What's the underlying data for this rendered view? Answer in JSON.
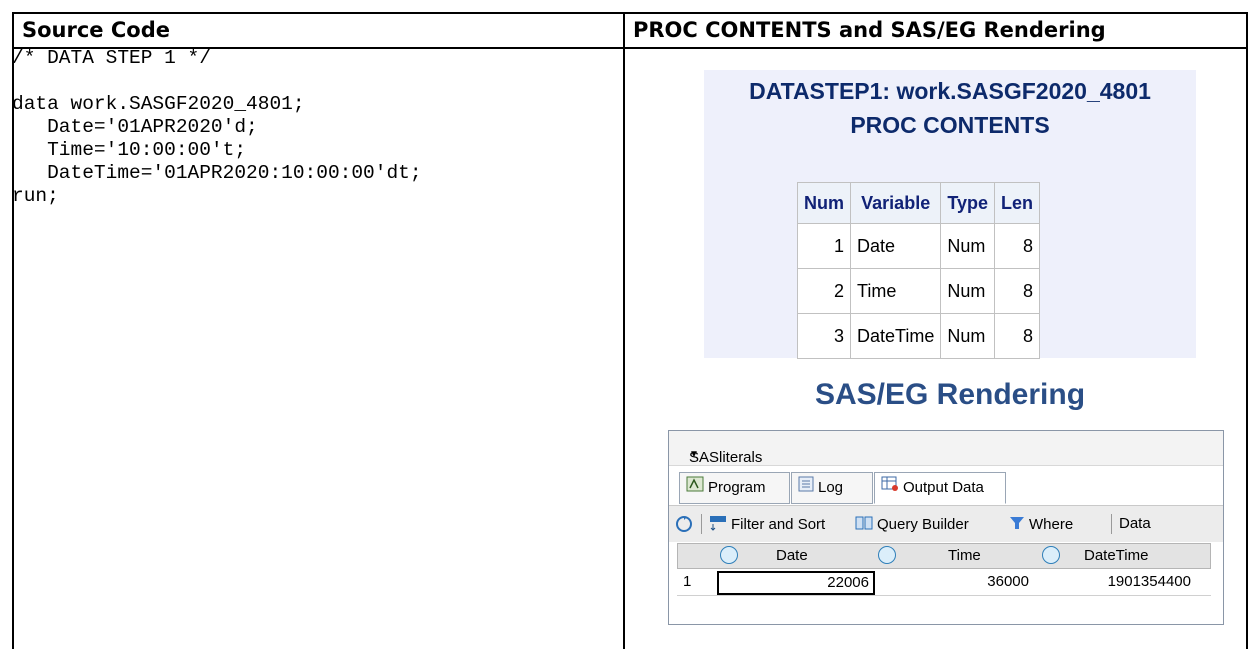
{
  "headers": {
    "left": "Source Code",
    "right": "PROC CONTENTS and SAS/EG Rendering"
  },
  "source_code": [
    "/* DATA STEP 1 */",
    "",
    "data work.SASGF2020_4801;",
    "   Date='01APR2020'd;",
    "   Time='10:00:00't;",
    "   DateTime='01APR2020:10:00:00'dt;",
    "run;"
  ],
  "proc_contents": {
    "title_line1": "DATASTEP1: work.SASGF2020_4801",
    "title_line2": "PROC CONTENTS",
    "columns": [
      "Num",
      "Variable",
      "Type",
      "Len"
    ],
    "rows": [
      [
        "1",
        "Date",
        "Num",
        "8"
      ],
      [
        "2",
        "Time",
        "Num",
        "8"
      ],
      [
        "3",
        "DateTime",
        "Num",
        "8"
      ]
    ]
  },
  "eg_title": "SAS/EG Rendering",
  "eg_window": {
    "project_label": "SASliterals",
    "tabs": [
      "Program",
      "Log",
      "Output Data"
    ],
    "toolbar": [
      "Filter and Sort",
      "Query Builder",
      "Where",
      "Data"
    ],
    "grid": {
      "columns": [
        "Date",
        "Time",
        "DateTime"
      ],
      "rows": [
        {
          "index": "1",
          "values": [
            "22006",
            "36000",
            "1901354400"
          ]
        }
      ]
    }
  }
}
